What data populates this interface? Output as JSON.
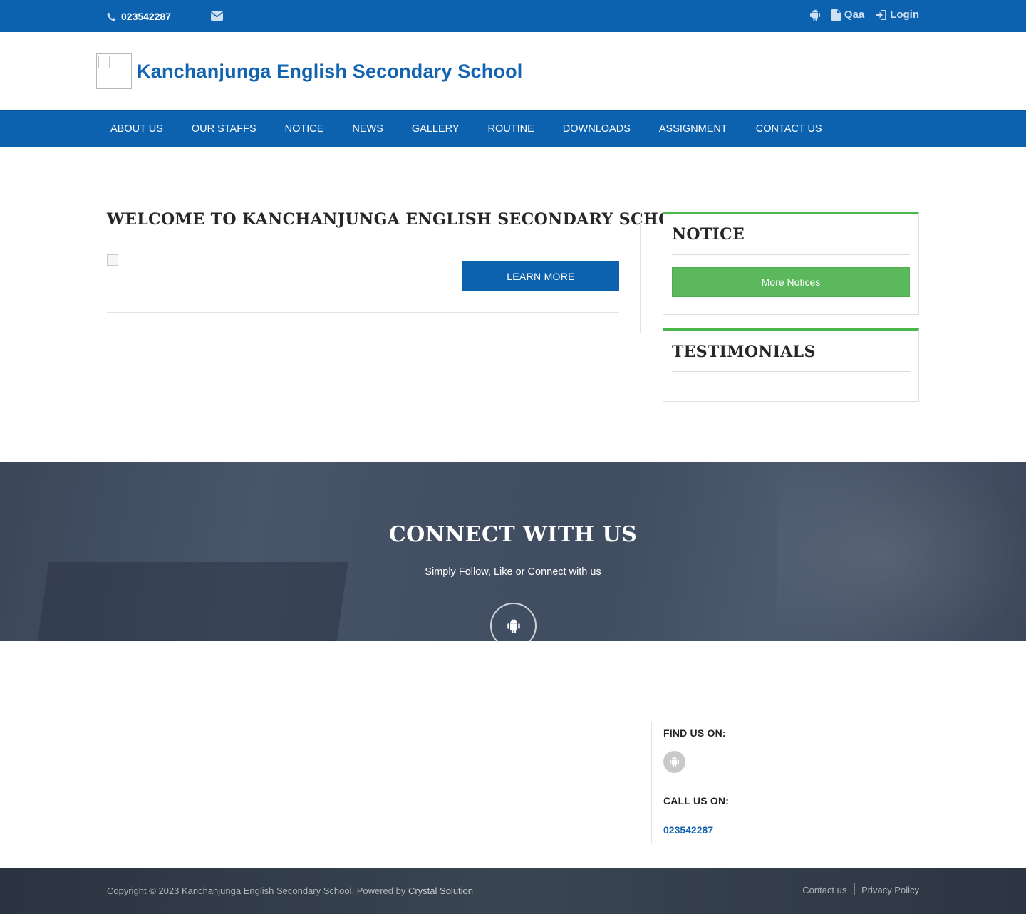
{
  "topbar": {
    "phone": "023542287",
    "links": [
      {
        "label": "",
        "icon": "android-icon"
      },
      {
        "label": "Qaa",
        "icon": "file-icon"
      },
      {
        "label": "Login",
        "icon": "sign-in-icon"
      }
    ]
  },
  "header": {
    "site_name": "Kanchanjunga English Secondary School"
  },
  "nav": {
    "items": [
      "ABOUT US",
      "OUR STAFFS",
      "NOTICE",
      "NEWS",
      "GALLERY",
      "ROUTINE",
      "DOWNLOADS",
      "ASSIGNMENT",
      "CONTACT US"
    ]
  },
  "welcome": {
    "title": "WELCOME TO KANCHANJUNGA ENGLISH SECONDARY SCHOOL",
    "button": "LEARN MORE"
  },
  "sidebar": {
    "notice_title": "NOTICE",
    "more_notices": "More Notices",
    "testimonials_title": "TESTIMONIALS"
  },
  "connect": {
    "title": "CONNECT WITH US",
    "subtitle": "Simply Follow, Like or Connect with us"
  },
  "footer": {
    "find_us": "FIND US ON:",
    "call_us": "CALL US ON:",
    "phone": "023542287",
    "copyright": "Copyright © 2023 Kanchanjunga English Secondary School. Powered by ",
    "powered_by": "Crystal Solution",
    "links": [
      "Contact us",
      "Privacy Policy"
    ],
    "separator": "|"
  },
  "colors": {
    "primary": "#0d62b0",
    "accent_green": "#5cb85c",
    "footer_bar": "#2f3a46"
  }
}
